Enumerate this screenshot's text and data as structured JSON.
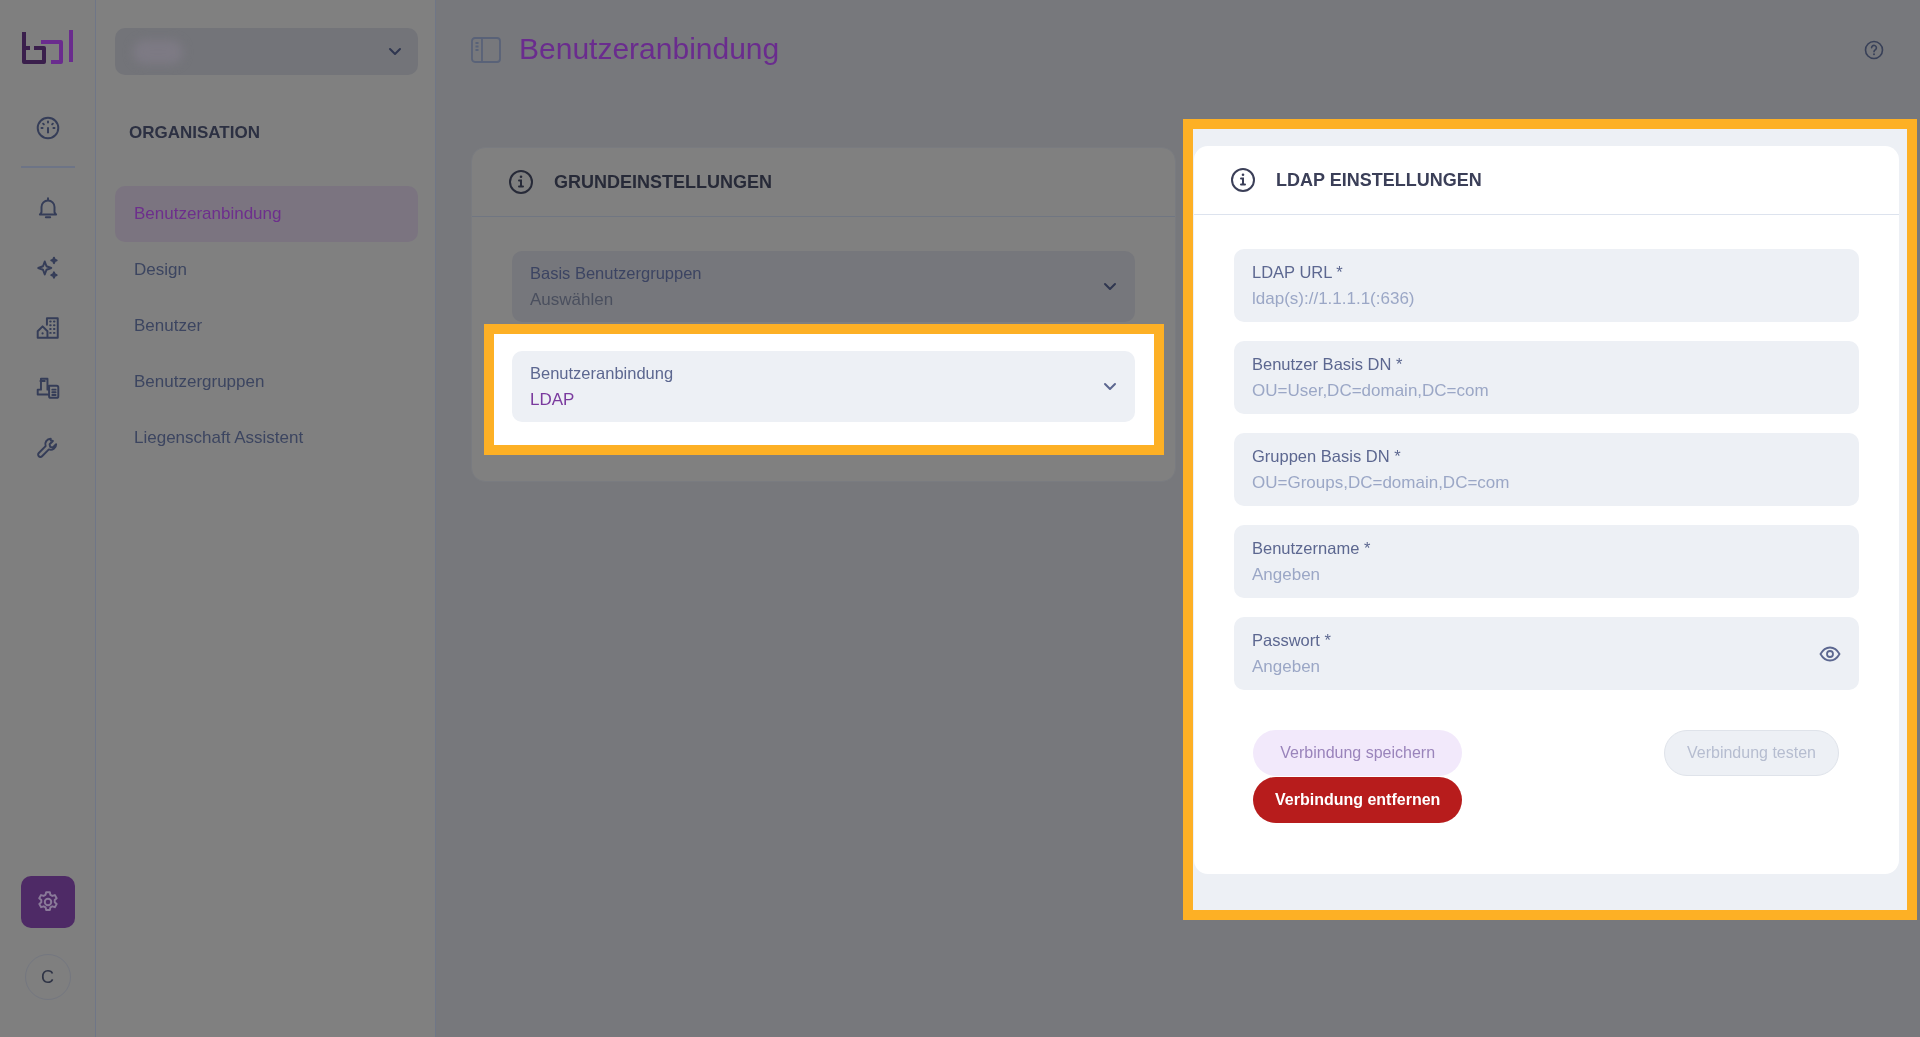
{
  "rail": {
    "items": [
      {
        "kind": "dashboard",
        "selected": false
      },
      {
        "kind": "bell",
        "selected": false
      },
      {
        "kind": "sparkles",
        "selected": false
      },
      {
        "kind": "buildings",
        "selected": false
      },
      {
        "kind": "property",
        "selected": false
      },
      {
        "kind": "wrench",
        "selected": false
      }
    ],
    "settings": {
      "selected": true
    },
    "avatar": "C"
  },
  "nav": {
    "section": "ORGANISATION",
    "items": [
      {
        "label": "Benutzeranbindung",
        "selected": true
      },
      {
        "label": "Design",
        "selected": false
      },
      {
        "label": "Benutzer",
        "selected": false
      },
      {
        "label": "Benutzergruppen",
        "selected": false
      },
      {
        "label": "Liegenschaft Assistent",
        "selected": false
      }
    ]
  },
  "header": {
    "title": "Benutzeranbindung"
  },
  "basic_settings": {
    "title": "GRUNDEINSTELLUNGEN",
    "highlighted": false,
    "fields": [
      {
        "kind": "select",
        "label": "Basis Benutzergruppen",
        "placeholder": "Auswählen",
        "highlighted": false
      },
      {
        "kind": "select",
        "label": "Benutzeranbindung",
        "value": "LDAP",
        "highlighted": true
      }
    ]
  },
  "ldap_settings": {
    "title": "LDAP EINSTELLUNGEN",
    "highlighted": true,
    "fields": [
      {
        "kind": "text",
        "label": "LDAP URL *",
        "placeholder": "ldap(s)://1.1.1.1(:636)"
      },
      {
        "kind": "text",
        "label": "Benutzer Basis DN *",
        "placeholder": "OU=User,DC=domain,DC=com"
      },
      {
        "kind": "text",
        "label": "Gruppen Basis DN *",
        "placeholder": "OU=Groups,DC=domain,DC=com"
      },
      {
        "kind": "text",
        "label": "Benutzername *",
        "placeholder": "Angeben"
      },
      {
        "kind": "password",
        "label": "Passwort *",
        "placeholder": "Angeben"
      }
    ],
    "buttons": [
      {
        "kind": "save",
        "label": "Verbindung speichern",
        "disabled": true
      },
      {
        "kind": "remove",
        "label": "Verbindung entfernen",
        "disabled": false
      },
      {
        "kind": "test",
        "label": "Verbindung testen",
        "disabled": true
      }
    ]
  }
}
